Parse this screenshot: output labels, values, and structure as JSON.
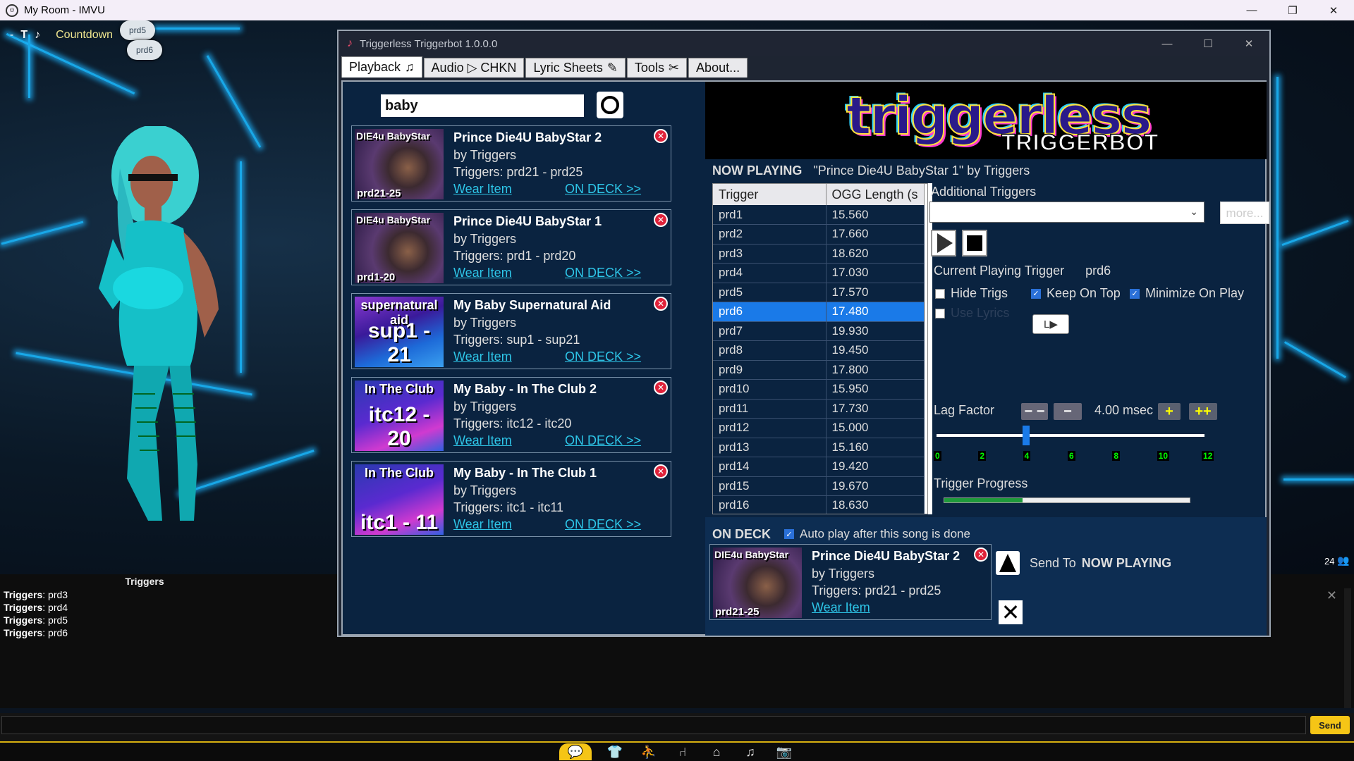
{
  "window": {
    "title": "My Room - IMVU",
    "icon": "imvu-app-icon"
  },
  "scene": {
    "hud_label": "Countdown",
    "bubbles": [
      "prd5",
      "prd6"
    ],
    "accent": "#18a8e8"
  },
  "triggerbot": {
    "title": "Triggerless Triggerbot 1.0.0.0",
    "tabs": [
      {
        "label": "Playback",
        "icon": "♫"
      },
      {
        "label": "Audio ▷ CHKN",
        "icon": ""
      },
      {
        "label": "Lyric Sheets",
        "icon": "✎"
      },
      {
        "label": "Tools",
        "icon": "✂"
      },
      {
        "label": "About...",
        "icon": ""
      }
    ],
    "search": {
      "value": "baby"
    },
    "songs": [
      {
        "title": "Prince Die4U BabyStar 2",
        "by": "by Triggers",
        "trigs": "Triggers: prd21 - prd25",
        "wear": "Wear Item",
        "deck": "ON DECK >>",
        "thumb_top": "DIE4u BabyStar",
        "thumb_bot": "prd21-25"
      },
      {
        "title": "Prince Die4U BabyStar 1",
        "by": "by Triggers",
        "trigs": "Triggers: prd1 - prd20",
        "wear": "Wear Item",
        "deck": "ON DECK >>",
        "thumb_top": "DIE4u BabyStar",
        "thumb_bot": "prd1-20"
      },
      {
        "title": "My Baby Supernatural Aid",
        "by": "by Triggers",
        "trigs": "Triggers: sup1 - sup21",
        "wear": "Wear Item",
        "deck": "ON DECK >>",
        "thumb_top": "supernatural aid",
        "thumb_bot": "sup1 - 21"
      },
      {
        "title": "My Baby - In The Club 2",
        "by": "by Triggers",
        "trigs": "Triggers: itc12 - itc20",
        "wear": "Wear Item",
        "deck": "ON DECK >>",
        "thumb_top": "In The Club",
        "thumb_bot": "itc12 - 20"
      },
      {
        "title": "My Baby - In The Club 1",
        "by": "by Triggers",
        "trigs": "Triggers: itc1 - itc11",
        "wear": "Wear Item",
        "deck": "ON DECK >>",
        "thumb_top": "In The Club",
        "thumb_bot": "itc1 - 11"
      }
    ],
    "logo": {
      "main": "triggerless",
      "sub": "TRIGGERBOT"
    },
    "now_playing": {
      "label": "NOW PLAYING",
      "value": "\"Prince Die4U BabyStar 1\" by Triggers"
    },
    "table": {
      "headers": [
        "Trigger",
        "OGG Length (s"
      ],
      "selected": "prd6",
      "rows": [
        [
          "prd1",
          "15.560"
        ],
        [
          "prd2",
          "17.660"
        ],
        [
          "prd3",
          "18.620"
        ],
        [
          "prd4",
          "17.030"
        ],
        [
          "prd5",
          "17.570"
        ],
        [
          "prd6",
          "17.480"
        ],
        [
          "prd7",
          "19.930"
        ],
        [
          "prd8",
          "19.450"
        ],
        [
          "prd9",
          "17.800"
        ],
        [
          "prd10",
          "15.950"
        ],
        [
          "prd11",
          "17.730"
        ],
        [
          "prd12",
          "15.000"
        ],
        [
          "prd13",
          "15.160"
        ],
        [
          "prd14",
          "19.420"
        ],
        [
          "prd15",
          "19.670"
        ],
        [
          "prd16",
          "18.630"
        ]
      ]
    },
    "additional_triggers": {
      "label": "Additional Triggers",
      "more_label": "more..."
    },
    "current_trigger": {
      "label": "Current Playing Trigger",
      "value": "prd6"
    },
    "options": {
      "hide_trigs": {
        "label": "Hide Trigs",
        "checked": false
      },
      "keep_on_top": {
        "label": "Keep On Top",
        "checked": true
      },
      "minimize_on_play": {
        "label": "Minimize On Play",
        "checked": true
      },
      "use_lyrics": {
        "label": "Use Lyrics",
        "checked": false
      }
    },
    "lyric_btn_label": "L▶",
    "lag": {
      "label": "Lag Factor",
      "value": "4.00 msec",
      "btn_minus2": "− −",
      "btn_minus": "−",
      "btn_plus": "+",
      "btn_plus2": "++",
      "ticks": [
        "0",
        "2",
        "4",
        "6",
        "8",
        "10",
        "12"
      ],
      "slider_value": 4,
      "slider_max": 12
    },
    "trigger_progress": {
      "label": "Trigger Progress",
      "fraction": 0.32
    },
    "on_deck": {
      "label": "ON DECK",
      "autoplay_label": "Auto play after this song is done",
      "song": {
        "title": "Prince Die4U BabyStar 2",
        "by": "by Triggers",
        "trigs": "Triggers: prd21 - prd25",
        "wear": "Wear Item",
        "thumb_top": "DIE4u BabyStar",
        "thumb_bot": "prd21-25"
      },
      "send_to": "Send To",
      "send_target": "NOW PLAYING"
    }
  },
  "chat": {
    "title": "Triggers",
    "lines": [
      {
        "who": "Triggers",
        "msg": ": prd3"
      },
      {
        "who": "Triggers",
        "msg": ": prd4"
      },
      {
        "who": "Triggers",
        "msg": ": prd5"
      },
      {
        "who": "Triggers",
        "msg": ": prd6"
      }
    ],
    "send_label": "Send",
    "count": "24"
  },
  "colors": {
    "accent": "#1a7ae8",
    "link": "#2ec6e8",
    "send": "#f5c516"
  }
}
